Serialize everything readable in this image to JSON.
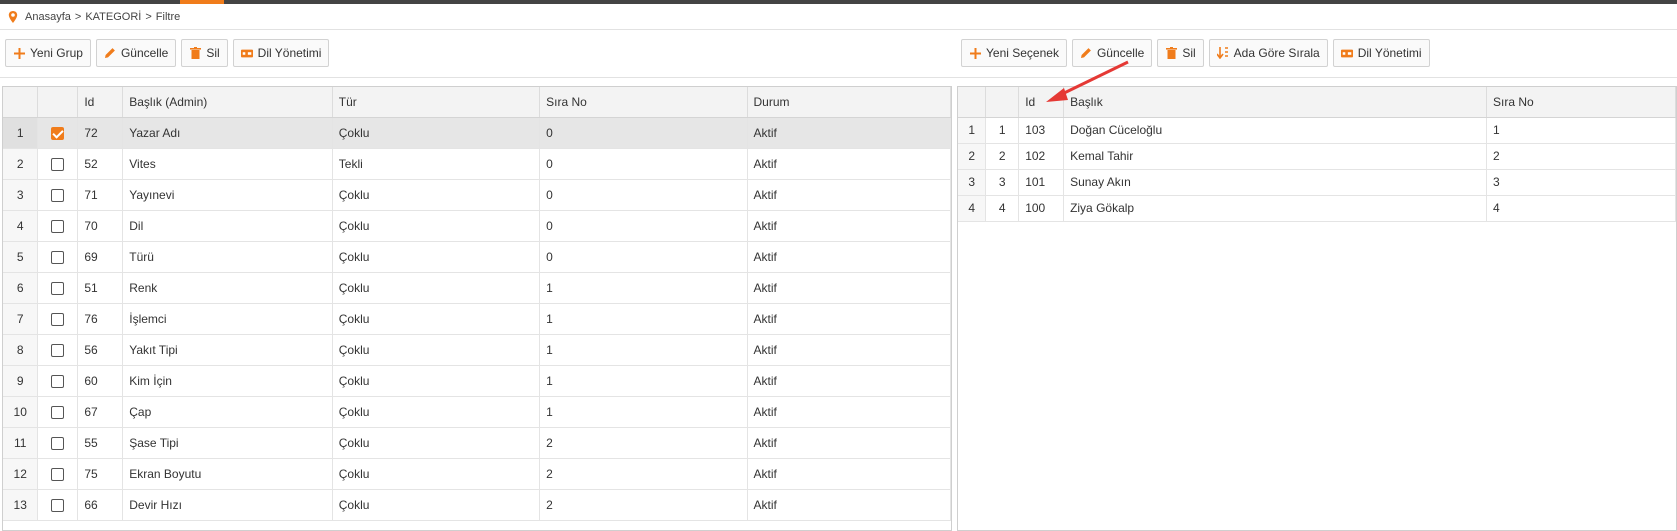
{
  "breadcrumb": {
    "items": [
      "Anasayfa",
      "KATEGORİ",
      "Filtre"
    ],
    "separator": ">"
  },
  "left_toolbar": {
    "new_group": "Yeni Grup",
    "update": "Güncelle",
    "delete": "Sil",
    "language": "Dil Yönetimi"
  },
  "right_toolbar": {
    "new_option": "Yeni Seçenek",
    "update": "Güncelle",
    "delete": "Sil",
    "sort_by_name": "Ada Göre Sırala",
    "language": "Dil Yönetimi"
  },
  "left_grid": {
    "headers": {
      "id": "Id",
      "title": "Başlık (Admin)",
      "type": "Tür",
      "order": "Sıra No",
      "status": "Durum"
    },
    "rows": [
      {
        "n": "1",
        "checked": true,
        "id": "72",
        "title": "Yazar Adı",
        "type": "Çoklu",
        "order": "0",
        "status": "Aktif"
      },
      {
        "n": "2",
        "checked": false,
        "id": "52",
        "title": "Vites",
        "type": "Tekli",
        "order": "0",
        "status": "Aktif"
      },
      {
        "n": "3",
        "checked": false,
        "id": "71",
        "title": "Yayınevi",
        "type": "Çoklu",
        "order": "0",
        "status": "Aktif"
      },
      {
        "n": "4",
        "checked": false,
        "id": "70",
        "title": "Dil",
        "type": "Çoklu",
        "order": "0",
        "status": "Aktif"
      },
      {
        "n": "5",
        "checked": false,
        "id": "69",
        "title": "Türü",
        "type": "Çoklu",
        "order": "0",
        "status": "Aktif"
      },
      {
        "n": "6",
        "checked": false,
        "id": "51",
        "title": "Renk",
        "type": "Çoklu",
        "order": "1",
        "status": "Aktif"
      },
      {
        "n": "7",
        "checked": false,
        "id": "76",
        "title": "İşlemci",
        "type": "Çoklu",
        "order": "1",
        "status": "Aktif"
      },
      {
        "n": "8",
        "checked": false,
        "id": "56",
        "title": "Yakıt Tipi",
        "type": "Çoklu",
        "order": "1",
        "status": "Aktif"
      },
      {
        "n": "9",
        "checked": false,
        "id": "60",
        "title": "Kim İçin",
        "type": "Çoklu",
        "order": "1",
        "status": "Aktif"
      },
      {
        "n": "10",
        "checked": false,
        "id": "67",
        "title": "Çap",
        "type": "Çoklu",
        "order": "1",
        "status": "Aktif"
      },
      {
        "n": "11",
        "checked": false,
        "id": "55",
        "title": "Şase Tipi",
        "type": "Çoklu",
        "order": "2",
        "status": "Aktif"
      },
      {
        "n": "12",
        "checked": false,
        "id": "75",
        "title": "Ekran Boyutu",
        "type": "Çoklu",
        "order": "2",
        "status": "Aktif"
      },
      {
        "n": "13",
        "checked": false,
        "id": "66",
        "title": "Devir Hızı",
        "type": "Çoklu",
        "order": "2",
        "status": "Aktif"
      }
    ]
  },
  "right_grid": {
    "headers": {
      "id": "Id",
      "title": "Başlık",
      "order": "Sıra No"
    },
    "rows": [
      {
        "n": "1",
        "n2": "1",
        "id": "103",
        "title": "Doğan Cüceloğlu",
        "order": "1"
      },
      {
        "n": "2",
        "n2": "2",
        "id": "102",
        "title": "Kemal Tahir",
        "order": "2"
      },
      {
        "n": "3",
        "n2": "3",
        "id": "101",
        "title": "Sunay Akın",
        "order": "3"
      },
      {
        "n": "4",
        "n2": "4",
        "id": "100",
        "title": "Ziya Gökalp",
        "order": "4"
      }
    ]
  },
  "colors": {
    "accent": "#f07c1b",
    "annotation_arrow": "#e53935"
  }
}
